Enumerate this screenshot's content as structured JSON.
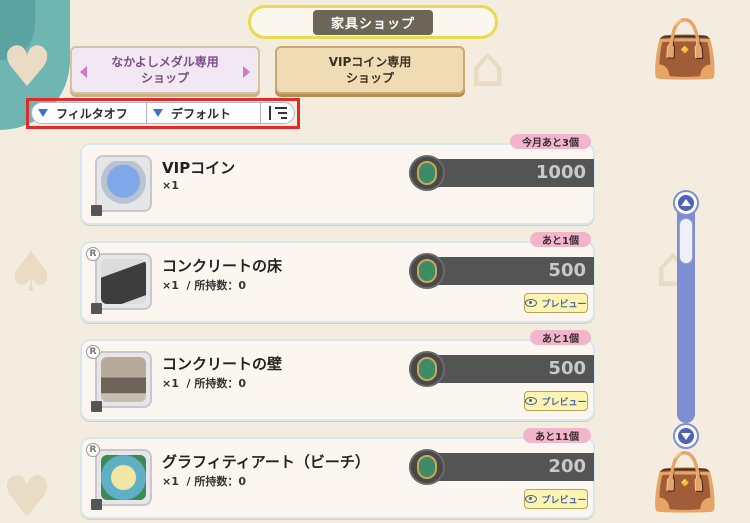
{
  "header": {
    "title": "家具ショップ"
  },
  "tabs": [
    {
      "label_line1": "なかよしメダル専用",
      "label_line2": "ショップ"
    },
    {
      "label_line1": "VIPコイン専用",
      "label_line2": "ショップ"
    }
  ],
  "filters": {
    "filter_label": "フィルタオフ",
    "sort_label": "デフォルト",
    "sort_order_icon": "sort-lines-icon"
  },
  "items": [
    {
      "name": "VIPコイン",
      "sub": "×1",
      "limit": "今月あと3個",
      "price": "1000",
      "rarity": "",
      "preview": ""
    },
    {
      "name": "コンクリートの床",
      "sub": "×1  / 所持数：0",
      "limit": "あと1個",
      "price": "500",
      "rarity": "R",
      "preview": "プレビュー"
    },
    {
      "name": "コンクリートの壁",
      "sub": "×1  / 所持数：0",
      "limit": "あと1個",
      "price": "500",
      "rarity": "R",
      "preview": "プレビュー"
    },
    {
      "name": "グラフィティアート（ビーチ）",
      "sub": "×1  / 所持数：0",
      "limit": "あと11個",
      "price": "200",
      "rarity": "R",
      "preview": "プレビュー"
    }
  ],
  "colors": {
    "accent_red_frame": "#e12a2a",
    "title_border": "#e6dc4d",
    "scroll": "#7d8ed3",
    "price_bar": "#545454",
    "limit_tag": "#f2b6cc"
  }
}
